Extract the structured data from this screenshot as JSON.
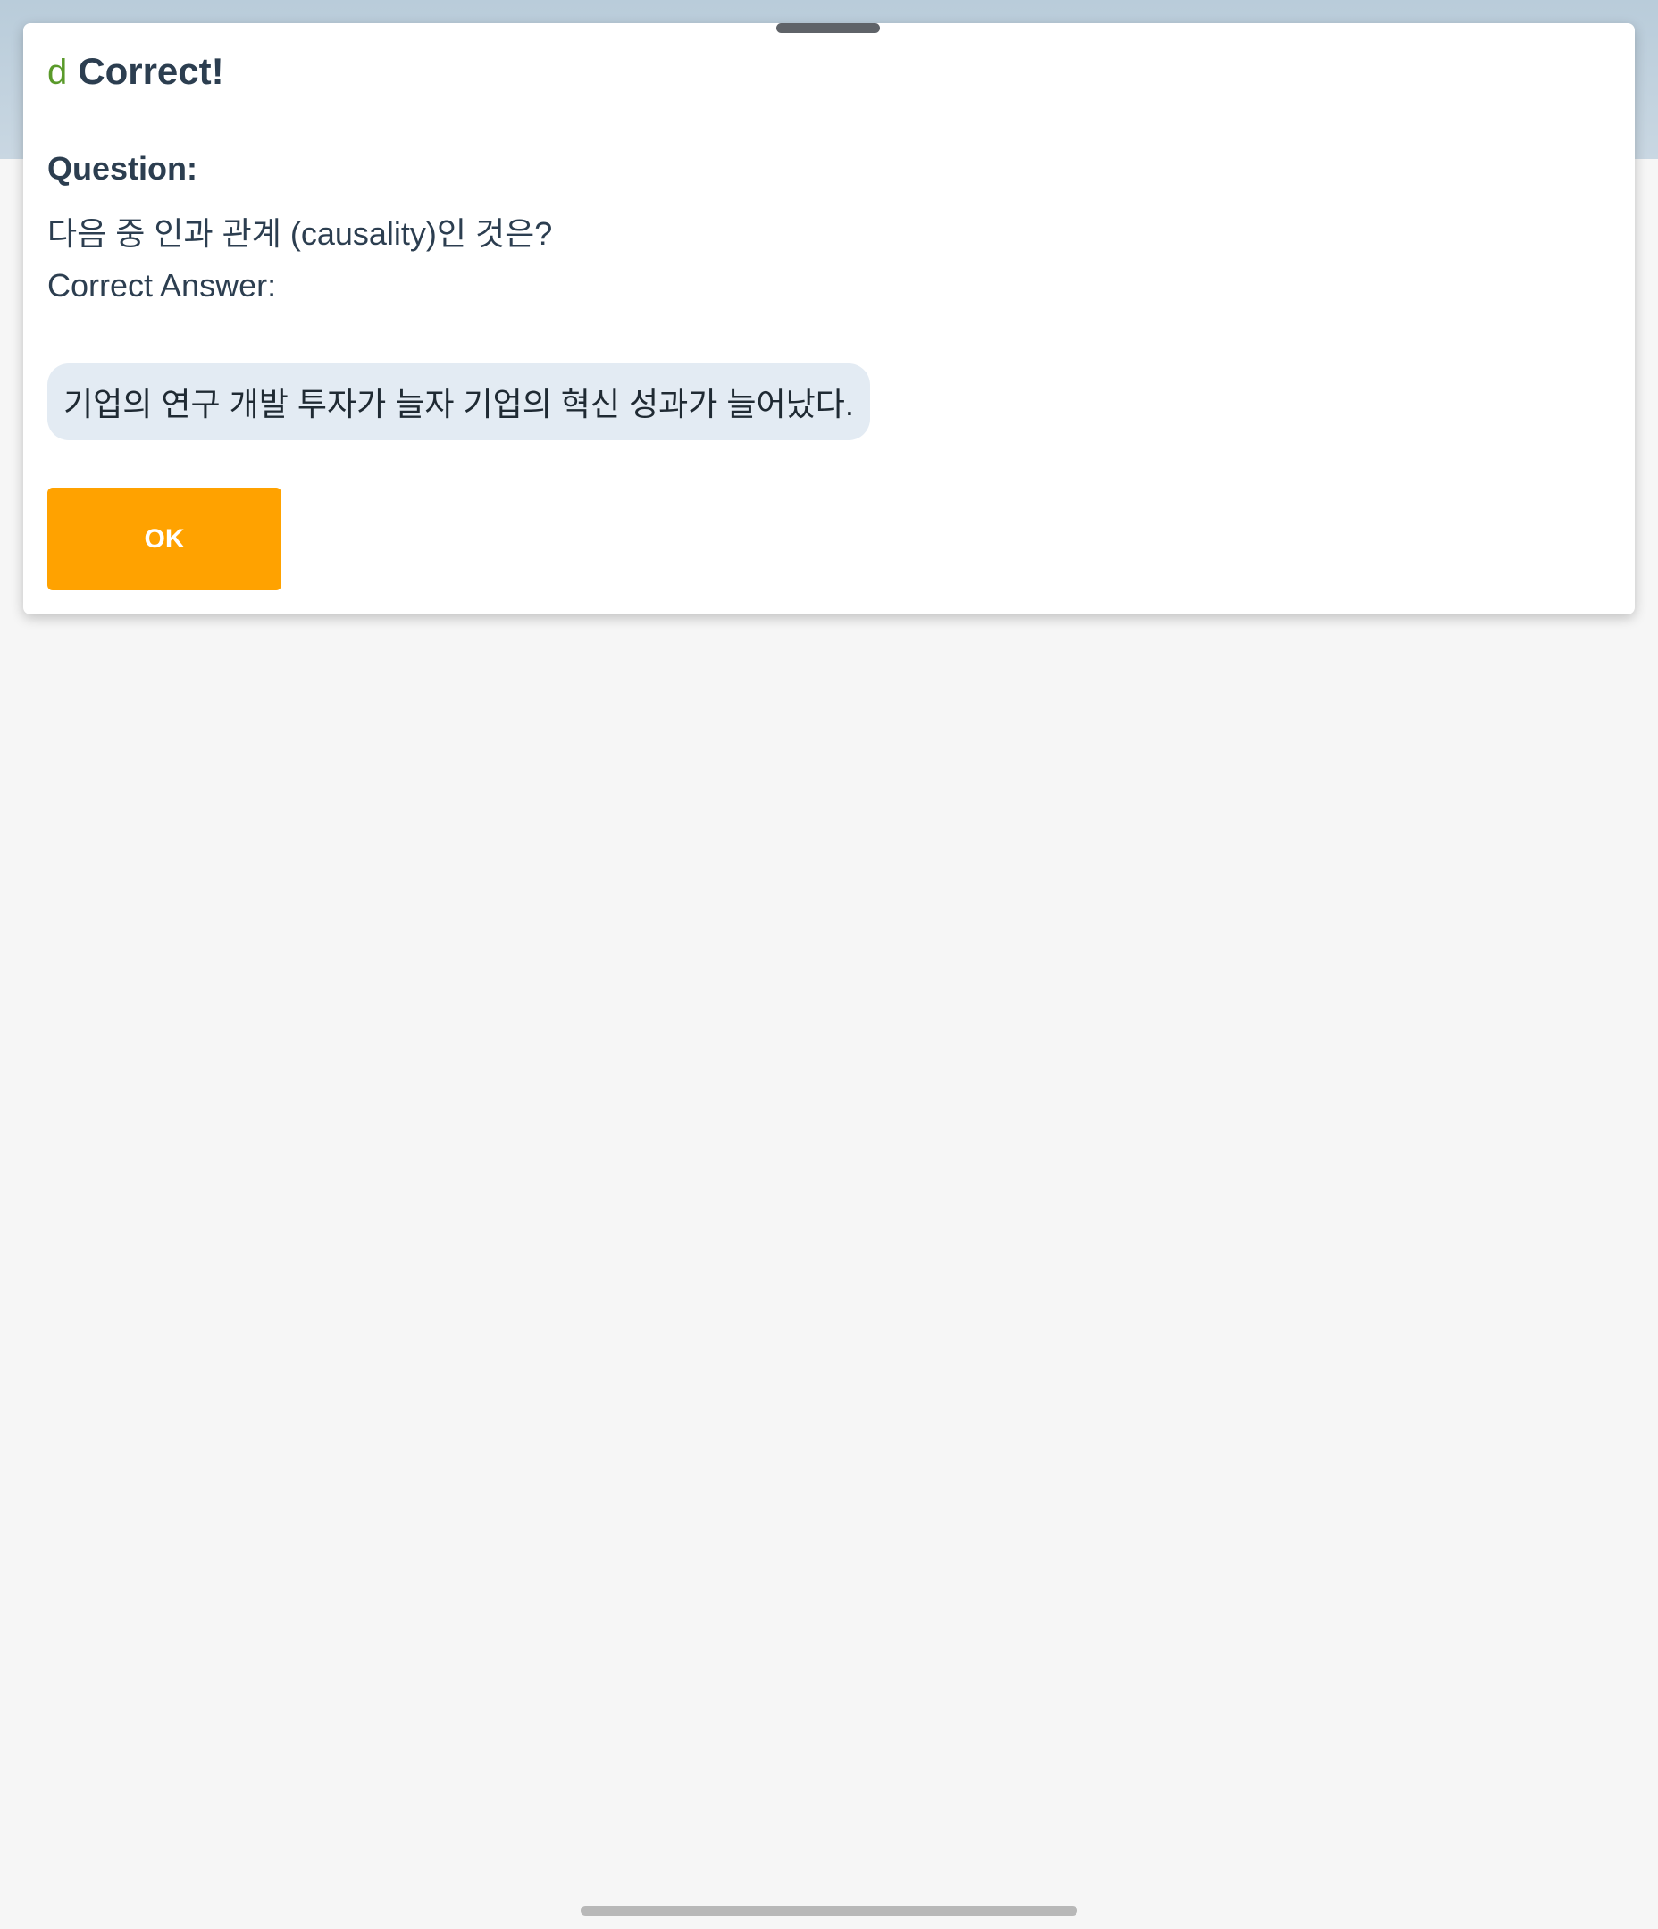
{
  "dialog": {
    "icon": "check-icon",
    "icon_glyph": "d",
    "icon_color": "#5a9a2a",
    "title": "Correct!",
    "question_label": "Question:",
    "question_text": "다음 중 인과 관계 (causality)인 것은?",
    "answer_label": "Correct Answer:",
    "answer_text": "기업의 연구 개발 투자가 늘자 기업의 혁신 성과가 늘어났다.",
    "ok_label": "OK",
    "ok_color": "#ffa200"
  }
}
